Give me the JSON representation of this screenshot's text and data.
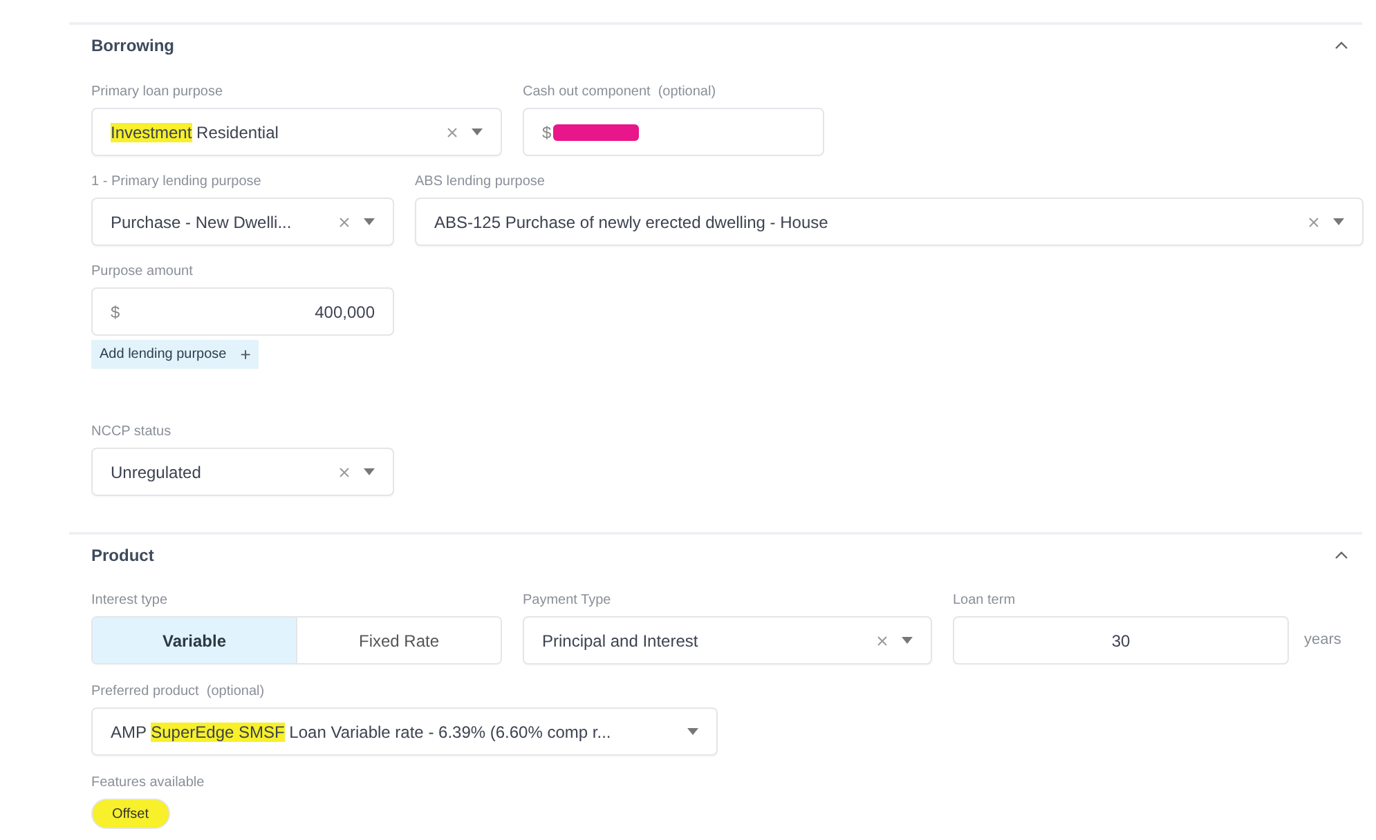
{
  "borrowing": {
    "title": "Borrowing",
    "expanded": true,
    "primary_loan_purpose": {
      "label": "Primary loan purpose",
      "value_parts": [
        {
          "text": "Investment",
          "highlighted": true
        },
        {
          "text": " Residential",
          "highlighted": false
        }
      ]
    },
    "cash_out": {
      "label": "Cash out component  (optional)",
      "value": "$",
      "redacted": true
    },
    "primary_lending_purpose": {
      "label": "1 - Primary lending purpose",
      "value": "Purchase - New Dwelli..."
    },
    "abs_lending_purpose": {
      "label": "ABS lending purpose",
      "value": "ABS-125 Purchase of newly erected dwelling - House"
    },
    "purpose_amount": {
      "label": "Purpose amount",
      "currency": "$",
      "value": "400,000"
    },
    "add_button": {
      "label": "Add lending purpose",
      "icon": "+"
    },
    "nccp_status": {
      "label": "NCCP status",
      "value": "Unregulated"
    }
  },
  "product": {
    "title": "Product",
    "expanded": true,
    "interest_type": {
      "label": "Interest type",
      "options": [
        {
          "label": "Variable",
          "selected": true
        },
        {
          "label": "Fixed Rate",
          "selected": false
        }
      ]
    },
    "payment_type": {
      "label": "Payment Type",
      "value": "Principal and Interest"
    },
    "loan_term": {
      "label": "Loan term",
      "value": "30",
      "unit": "years"
    },
    "preferred_product": {
      "label": "Preferred product  (optional)",
      "value_parts": [
        {
          "text": "AMP ",
          "highlighted": false
        },
        {
          "text": "SuperEdge SMSF",
          "highlighted": true
        },
        {
          "text": " Loan Variable rate - 6.39% (6.60% comp r...",
          "highlighted": false
        }
      ]
    },
    "features": {
      "label": "Features available",
      "chips": [
        {
          "label": "Offset",
          "highlighted": true
        }
      ]
    }
  }
}
